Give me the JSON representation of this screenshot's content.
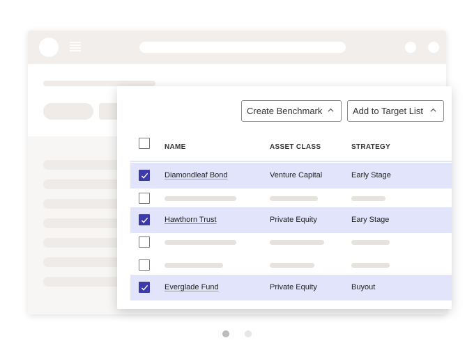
{
  "toolbar": {
    "create_benchmark_label": "Create Benchmark",
    "add_to_target_list_label": "Add to Target List"
  },
  "table": {
    "columns": [
      "NAME",
      "ASSET CLASS",
      "STRATEGY"
    ],
    "rows": [
      {
        "name": "Diamondleaf Bond",
        "asset_class": "Venture Capital",
        "strategy": "Early Stage",
        "selected": true
      },
      {
        "name": "",
        "asset_class": "",
        "strategy": "",
        "selected": false
      },
      {
        "name": "Hawthorn Trust",
        "asset_class": "Private Equity",
        "strategy": "Eary Stage",
        "selected": true
      },
      {
        "name": "",
        "asset_class": "",
        "strategy": "",
        "selected": false
      },
      {
        "name": "",
        "asset_class": "",
        "strategy": "",
        "selected": false
      },
      {
        "name": "Everglade Fund",
        "asset_class": "Private Equity",
        "strategy": "Buyout",
        "selected": true
      }
    ]
  },
  "colors": {
    "accent": "#3b3aa8",
    "selected_row": "#e1e4fb",
    "placeholder": "#e6e2dd"
  },
  "pagination": {
    "pages": 2,
    "current": 1
  }
}
